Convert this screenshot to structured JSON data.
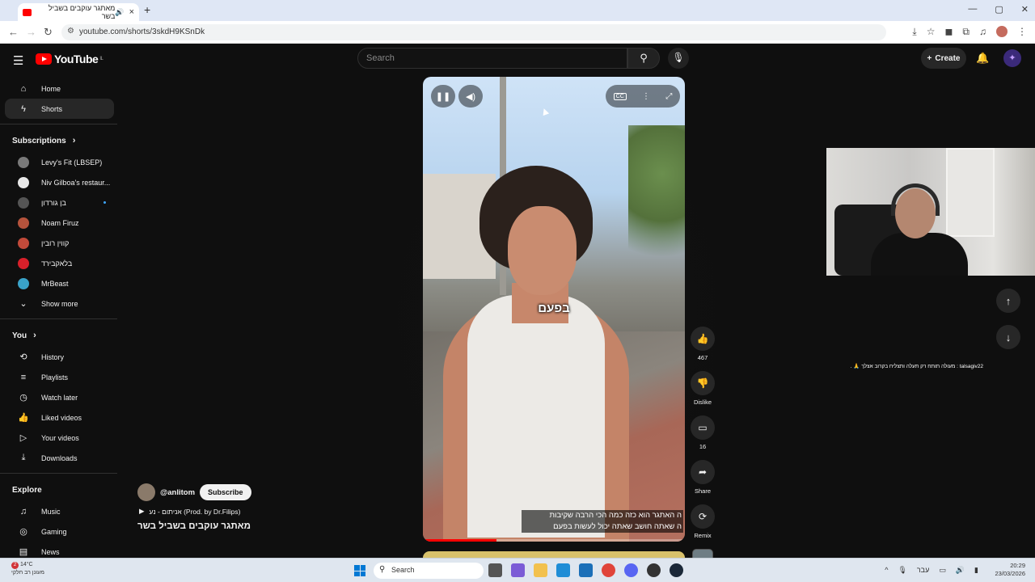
{
  "browser": {
    "tab_title": "מאתגר עוקבים בשביל בשר",
    "new_tab": "+",
    "url": "youtube.com/shorts/3skdH9KSnDk",
    "controls": {
      "minimize": "—",
      "maximize": "▢",
      "close": "✕"
    }
  },
  "header": {
    "logo_text": "YouTube",
    "logo_region": "IL",
    "search_placeholder": "Search",
    "create_label": "Create"
  },
  "sidebar": {
    "primary": [
      {
        "label": "Home",
        "icon": "home-icon"
      },
      {
        "label": "Shorts",
        "icon": "shorts-icon",
        "active": true
      }
    ],
    "subscriptions_title": "Subscriptions",
    "subscriptions": [
      {
        "label": "Levy's Fit (LBSEP)",
        "color": "#7a7a7a"
      },
      {
        "label": "Niv Gilboa's restaur...",
        "color": "#e8e8e8"
      },
      {
        "label": "בן גורדון",
        "color": "#555555",
        "new": true
      },
      {
        "label": "Noam Firuz",
        "color": "#b5533c"
      },
      {
        "label": "קווין רובין",
        "color": "#c14a3a"
      },
      {
        "label": "בלאקבירד",
        "color": "#d8202a"
      },
      {
        "label": "MrBeast",
        "color": "#3aa3c9"
      }
    ],
    "show_more": "Show more",
    "you_title": "You",
    "you_items": [
      {
        "label": "History",
        "icon": "history-icon"
      },
      {
        "label": "Playlists",
        "icon": "playlists-icon"
      },
      {
        "label": "Watch later",
        "icon": "watch-later-icon"
      },
      {
        "label": "Liked videos",
        "icon": "liked-icon"
      },
      {
        "label": "Your videos",
        "icon": "your-videos-icon"
      },
      {
        "label": "Downloads",
        "icon": "downloads-icon"
      }
    ],
    "explore_title": "Explore",
    "explore_items": [
      {
        "label": "Music",
        "icon": "music-icon"
      },
      {
        "label": "Gaming",
        "icon": "gaming-icon"
      },
      {
        "label": "News",
        "icon": "news-icon"
      }
    ]
  },
  "short": {
    "caption_middle": "בפעם",
    "caption_bottom_line1": "ה האתגר הוא כזה כמה הכי הרבה שקיבות",
    "caption_bottom_line2": "ה שאתה חושב שאתה יכול לעשות בפעם",
    "progress_fraction": 0.28,
    "channel": "@anlitom",
    "subscribe_label": "Subscribe",
    "music": "אניתום - נע (Prod. by Dr.Filips)",
    "title": "מאתגר עוקבים בשביל בשר"
  },
  "actions": [
    {
      "icon": "like-icon",
      "label": "467"
    },
    {
      "icon": "dislike-icon",
      "label": "Dislike"
    },
    {
      "icon": "comment-icon",
      "label": "16"
    },
    {
      "icon": "share-icon",
      "label": "Share"
    },
    {
      "icon": "remix-icon",
      "label": "Remix"
    }
  ],
  "overlay": {
    "chat_line": "talsagiv22 : מעולה תותח רק תעלה ותצליח בקרוב אצלך 🙏 ."
  },
  "taskbar": {
    "temperature": "14°C",
    "weather_text": "מעונן רב חלקי",
    "notification_count": "2",
    "search_label": "Search",
    "lang": "עבר",
    "time": "20:29",
    "date": "23/03/2026"
  }
}
